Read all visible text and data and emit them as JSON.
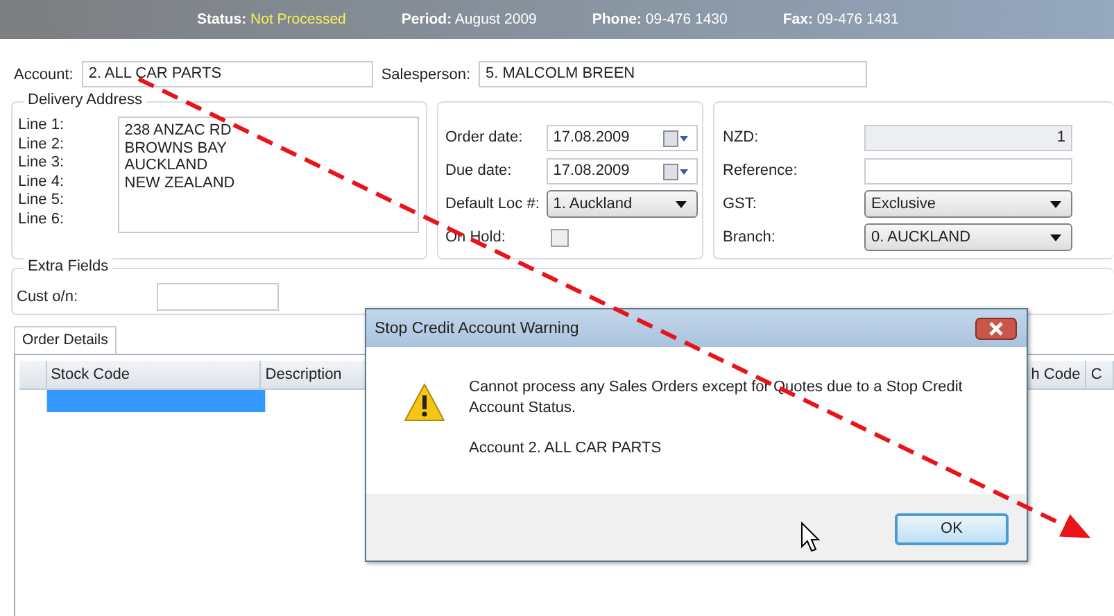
{
  "header": {
    "fields": [
      {
        "kind": "status",
        "label": "Status:",
        "value": "Not Processed"
      },
      {
        "kind": "plain",
        "label": "Period:",
        "value": "August 2009"
      },
      {
        "kind": "plain",
        "label": "Phone:",
        "value": "09-476 1430"
      },
      {
        "kind": "plain",
        "label": "Fax:",
        "value": "09-476 1431"
      }
    ]
  },
  "account": {
    "label": "Account:",
    "value": "2. ALL CAR PARTS"
  },
  "salesperson": {
    "label": "Salesperson:",
    "value": "5. MALCOLM BREEN"
  },
  "delivery_address": {
    "title": "Delivery Address",
    "line_labels": [
      "Line 1:",
      "Line 2:",
      "Line 3:",
      "Line 4:",
      "Line 5:",
      "Line 6:"
    ],
    "lines": [
      "238 ANZAC RD",
      "BROWNS BAY",
      "AUCKLAND",
      "NEW ZEALAND"
    ]
  },
  "order": {
    "fields": [
      {
        "kind": "date",
        "label": "Order date:",
        "value": "17.08.2009"
      },
      {
        "kind": "date",
        "label": "Due date:",
        "value": "17.08.2009"
      },
      {
        "kind": "select",
        "label": "Default Loc #:",
        "value": "1. Auckland"
      },
      {
        "kind": "checkbox",
        "label": "On Hold:",
        "checked": false
      }
    ]
  },
  "currency": {
    "fields": [
      {
        "kind": "readonly",
        "label": "NZD:",
        "value": "1"
      },
      {
        "kind": "text",
        "label": "Reference:"
      },
      {
        "kind": "select",
        "label": "GST:",
        "value": "Exclusive"
      },
      {
        "kind": "select",
        "label": "Branch:",
        "value": "0. AUCKLAND"
      }
    ]
  },
  "extra_fields": {
    "title": "Extra Fields",
    "fields": [
      {
        "label": "Cust o/n:"
      }
    ]
  },
  "tabs": [
    {
      "label": "Order Details",
      "selected": true
    }
  ],
  "table": {
    "columns": [
      "Stock Code",
      "Description",
      "h Code",
      "C"
    ],
    "rows": [
      {
        "selected": true
      }
    ]
  },
  "dialog": {
    "title": "Stop Credit Account Warning",
    "message": "Cannot process any Sales Orders except for Quotes due to a Stop Credit Account Status.",
    "detail": "Account 2. ALL CAR PARTS",
    "buttons": [
      "OK"
    ]
  }
}
